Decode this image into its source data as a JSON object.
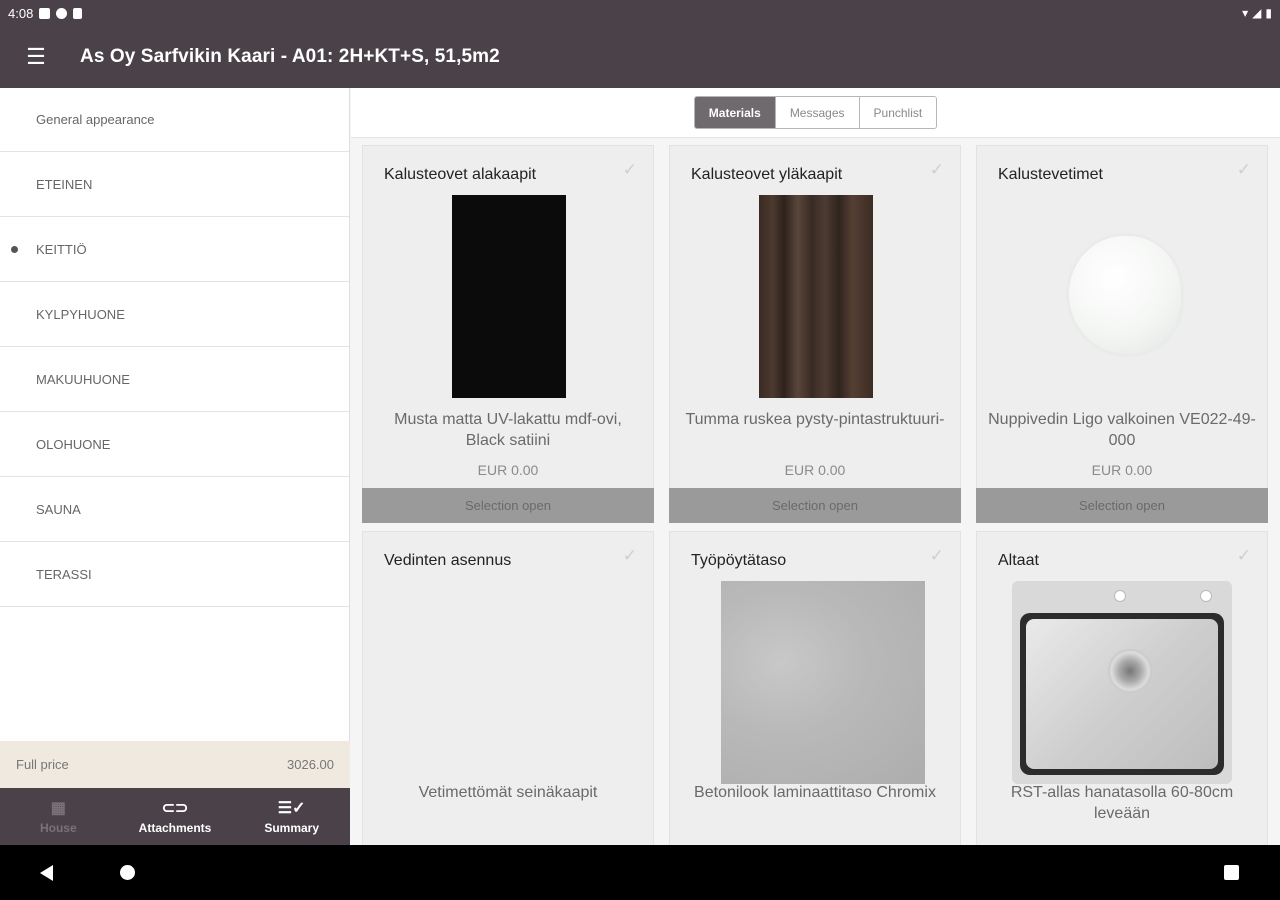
{
  "status_bar": {
    "time": "4:08"
  },
  "app_bar": {
    "title": "As Oy Sarfvikin Kaari - A01: 2H+KT+S, 51,5m2",
    "menu_icon": "hamburger-icon"
  },
  "sidebar": {
    "items": [
      {
        "label": "General appearance",
        "selected": false
      },
      {
        "label": "ETEINEN",
        "selected": false
      },
      {
        "label": "KEITTIÖ",
        "selected": true
      },
      {
        "label": "KYLPYHUONE",
        "selected": false
      },
      {
        "label": "MAKUUHUONE",
        "selected": false
      },
      {
        "label": "OLOHUONE",
        "selected": false
      },
      {
        "label": "SAUNA",
        "selected": false
      },
      {
        "label": "TERASSI",
        "selected": false
      }
    ],
    "full_price_label": "Full price",
    "full_price_value": "3026.00"
  },
  "bottom_nav": {
    "items": [
      {
        "label": "House",
        "icon": "building-icon",
        "enabled": false
      },
      {
        "label": "Attachments",
        "icon": "paperclip-icon",
        "enabled": true
      },
      {
        "label": "Summary",
        "icon": "checklist-icon",
        "enabled": true
      }
    ]
  },
  "tabs": [
    {
      "label": "Materials",
      "active": true
    },
    {
      "label": "Messages",
      "active": false
    },
    {
      "label": "Punchlist",
      "active": false
    }
  ],
  "cards": [
    {
      "title": "Kalusteovet alakaapit",
      "name": "Musta matta UV-lakattu mdf-ovi, Black satiini",
      "price": "EUR 0.00",
      "button": "Selection open",
      "image": "black-panel"
    },
    {
      "title": "Kalusteovet yläkaapit",
      "name": "Tumma ruskea pysty-pintastruktuuri-",
      "price": "EUR 0.00",
      "button": "Selection open",
      "image": "dark-wood-panel"
    },
    {
      "title": "Kalustevetimet",
      "name": "Nuppivedin Ligo valkoinen VE022-49-000",
      "price": "EUR 0.00",
      "button": "Selection open",
      "image": "white-knob"
    },
    {
      "title": "Vedinten asennus",
      "name": "Vetimettömät seinäkaapit",
      "image": ""
    },
    {
      "title": "Työpöytätaso",
      "name": "Betonilook laminaattitaso Chromix",
      "image": "concrete-surface"
    },
    {
      "title": "Altaat",
      "name": "RST-allas hanatasolla 60-80cm leveään",
      "image": "steel-sink"
    }
  ]
}
